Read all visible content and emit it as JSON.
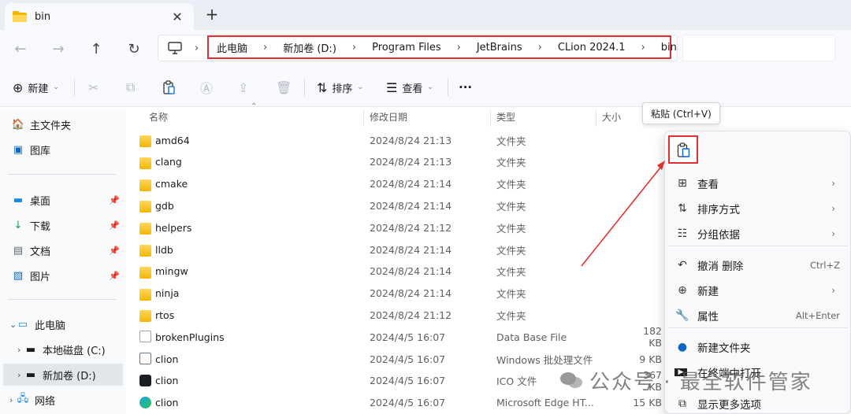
{
  "window": {
    "tab_title": "bin",
    "tab_close": "✕",
    "new_tab": "+"
  },
  "nav": {
    "breadcrumbs": [
      "此电脑",
      "新加卷 (D:)",
      "Program Files",
      "JetBrains",
      "CLion 2024.1",
      "bin"
    ]
  },
  "toolbar": {
    "new_label": "新建",
    "sort_label": "排序",
    "view_label": "查看",
    "more_label": "···"
  },
  "sidebar": {
    "quick": [
      {
        "label": "主文件夹",
        "icon": "home-icon"
      },
      {
        "label": "图库",
        "icon": "gallery-icon"
      }
    ],
    "pinned": [
      {
        "label": "桌面",
        "icon": "desktop-icon"
      },
      {
        "label": "下载",
        "icon": "download-icon"
      },
      {
        "label": "文档",
        "icon": "document-icon"
      },
      {
        "label": "图片",
        "icon": "picture-icon"
      }
    ],
    "tree": [
      {
        "label": "此电脑",
        "icon": "computer-icon"
      },
      {
        "label": "本地磁盘 (C:)",
        "icon": "drive-icon"
      },
      {
        "label": "新加卷 (D:)",
        "icon": "drive-icon"
      },
      {
        "label": "网络",
        "icon": "network-icon"
      }
    ]
  },
  "columns": {
    "name": "名称",
    "date": "修改日期",
    "type": "类型",
    "size": "大小"
  },
  "files": [
    {
      "name": "amd64",
      "date": "2024/8/24 21:13",
      "type": "文件夹",
      "size": "",
      "kind": "folder"
    },
    {
      "name": "clang",
      "date": "2024/8/24 21:13",
      "type": "文件夹",
      "size": "",
      "kind": "folder"
    },
    {
      "name": "cmake",
      "date": "2024/8/24 21:14",
      "type": "文件夹",
      "size": "",
      "kind": "folder"
    },
    {
      "name": "gdb",
      "date": "2024/8/24 21:14",
      "type": "文件夹",
      "size": "",
      "kind": "folder"
    },
    {
      "name": "helpers",
      "date": "2024/8/24 21:12",
      "type": "文件夹",
      "size": "",
      "kind": "folder"
    },
    {
      "name": "lldb",
      "date": "2024/8/24 21:14",
      "type": "文件夹",
      "size": "",
      "kind": "folder"
    },
    {
      "name": "mingw",
      "date": "2024/8/24 21:14",
      "type": "文件夹",
      "size": "",
      "kind": "folder"
    },
    {
      "name": "ninja",
      "date": "2024/8/24 21:14",
      "type": "文件夹",
      "size": "",
      "kind": "folder"
    },
    {
      "name": "rtos",
      "date": "2024/8/24 21:12",
      "type": "文件夹",
      "size": "",
      "kind": "folder"
    },
    {
      "name": "brokenPlugins",
      "date": "2024/4/5 16:07",
      "type": "Data Base File",
      "size": "182 KB",
      "kind": "file"
    },
    {
      "name": "clion",
      "date": "2024/4/5 16:07",
      "type": "Windows 批处理文件",
      "size": "9 KB",
      "kind": "bat"
    },
    {
      "name": "clion",
      "date": "2024/4/5 16:07",
      "type": "ICO 文件",
      "size": "367 KB",
      "kind": "ico"
    },
    {
      "name": "clion",
      "date": "2024/4/5 16:07",
      "type": "Microsoft Edge HT...",
      "size": "15 KB",
      "kind": "edge"
    }
  ],
  "tooltip": "粘贴 (Ctrl+V)",
  "context_menu": {
    "items": [
      {
        "label": "查看",
        "icon": "grid-icon",
        "shortcut": "",
        "submenu": true
      },
      {
        "label": "排序方式",
        "icon": "sort-icon",
        "shortcut": "",
        "submenu": true
      },
      {
        "label": "分组依据",
        "icon": "group-icon",
        "shortcut": "",
        "submenu": true
      },
      {
        "label": "撤消 删除",
        "icon": "undo-icon",
        "shortcut": "Ctrl+Z",
        "submenu": false
      },
      {
        "label": "新建",
        "icon": "plus-circle-icon",
        "shortcut": "",
        "submenu": true
      },
      {
        "label": "属性",
        "icon": "wrench-icon",
        "shortcut": "Alt+Enter",
        "submenu": false
      },
      {
        "label": "新建文件夹",
        "icon": "new-folder-icon",
        "shortcut": "",
        "submenu": false
      },
      {
        "label": "在终端中打开",
        "icon": "terminal-icon",
        "shortcut": "",
        "submenu": false
      },
      {
        "label": "显示更多选项",
        "icon": "more-options-icon",
        "shortcut": "",
        "submenu": false
      }
    ]
  },
  "watermark": "公众号 · 最全软件管家",
  "colors": {
    "highlight_red": "#e03131",
    "folder_yellow": "#f2b705",
    "accent_blue": "#0a66c2"
  }
}
